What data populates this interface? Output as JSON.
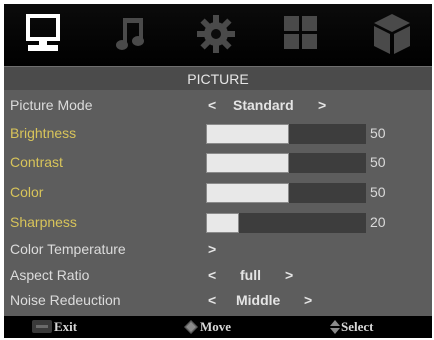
{
  "tabs": [
    {
      "name": "monitor-icon",
      "active": true
    },
    {
      "name": "music-note-icon",
      "active": false
    },
    {
      "name": "gear-icon",
      "active": false
    },
    {
      "name": "grid-icon",
      "active": false
    },
    {
      "name": "cube-icon",
      "active": false
    }
  ],
  "menu": {
    "title": "PICTURE",
    "picture_mode": {
      "label": "Picture Mode",
      "value": "Standard",
      "left_arrow": "<",
      "right_arrow": ">"
    },
    "brightness": {
      "label": "Brightness",
      "value": "50",
      "level": 50
    },
    "contrast": {
      "label": "Contrast",
      "value": "50",
      "level": 50
    },
    "color": {
      "label": "Color",
      "value": "50",
      "level": 50
    },
    "sharpness": {
      "label": "Sharpness",
      "value": "20",
      "level": 20
    },
    "color_temperature": {
      "label": "Color Temperature",
      "arrow": ">"
    },
    "aspect_ratio": {
      "label": "Aspect Ratio",
      "value": "full",
      "left_arrow": "<",
      "right_arrow": ">"
    },
    "noise_reduction": {
      "label": "Noise Redeuction",
      "value": "Middle",
      "left_arrow": "<",
      "right_arrow": ">"
    }
  },
  "footer": {
    "exit_label": "Exit",
    "move_label": "Move",
    "select_label": "Select"
  },
  "colors": {
    "highlight_label": "#d8c45a",
    "background": "#5d5d5d"
  }
}
